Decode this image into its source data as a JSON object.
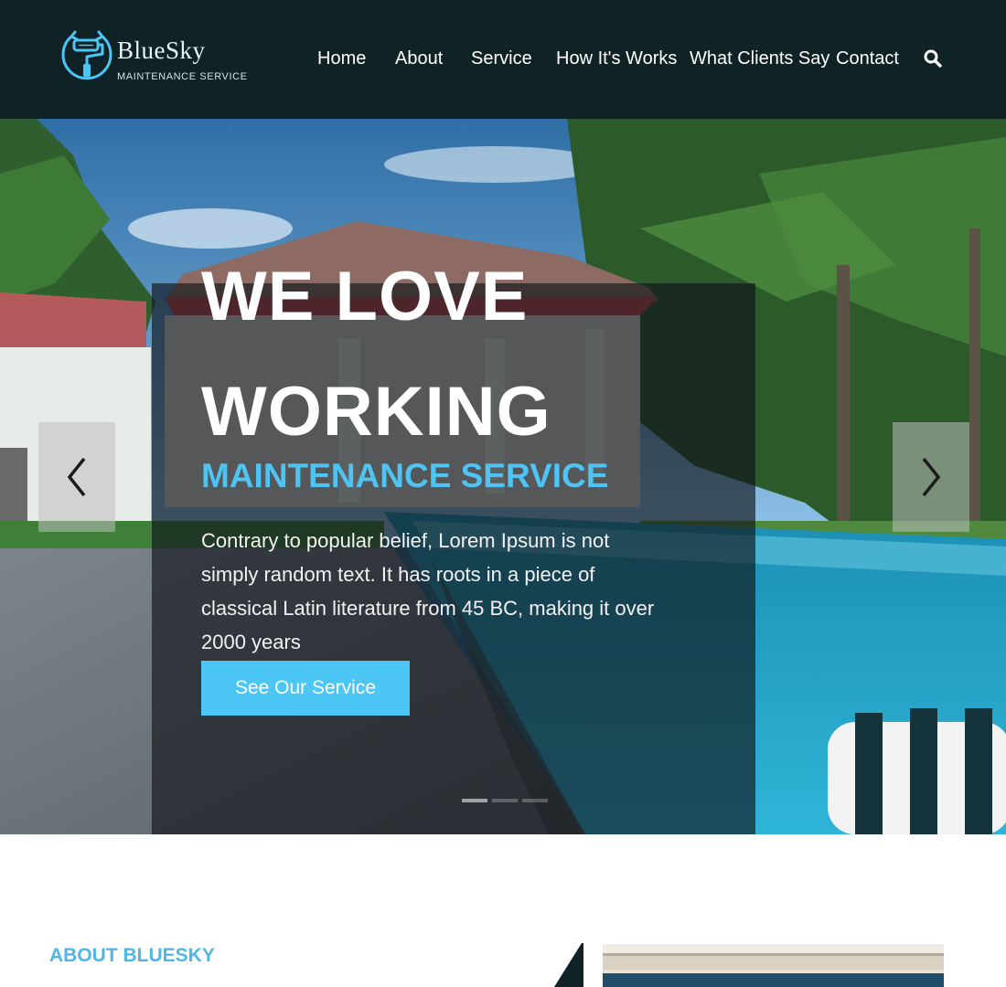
{
  "brand": {
    "name": "BlueSky",
    "tagline": "MAINTENANCE SERVICE",
    "accent": "#4cc6f5",
    "header_bg": "#0f2226",
    "logo_icon": "paint-roller-icon"
  },
  "nav": {
    "items": [
      {
        "label": "Home"
      },
      {
        "label": "About"
      },
      {
        "label": "Service"
      },
      {
        "label": "How It's Works"
      },
      {
        "label": "What Clients Say"
      },
      {
        "label": "Contact"
      }
    ],
    "search_icon": "search-icon"
  },
  "hero": {
    "title": "WE LOVE WORKING",
    "subtitle": "MAINTENANCE SERVICE",
    "description": "Contrary to popular belief, Lorem Ipsum is not simply random text. It has roots in a piece of classical Latin literature from 45 BC, making it over 2000 years",
    "cta_label": "See Our Service",
    "prev_icon": "chevron-left-icon",
    "next_icon": "chevron-right-icon",
    "slides": 3,
    "active_slide": 1
  },
  "about": {
    "label": "ABOUT BLUESKY"
  }
}
